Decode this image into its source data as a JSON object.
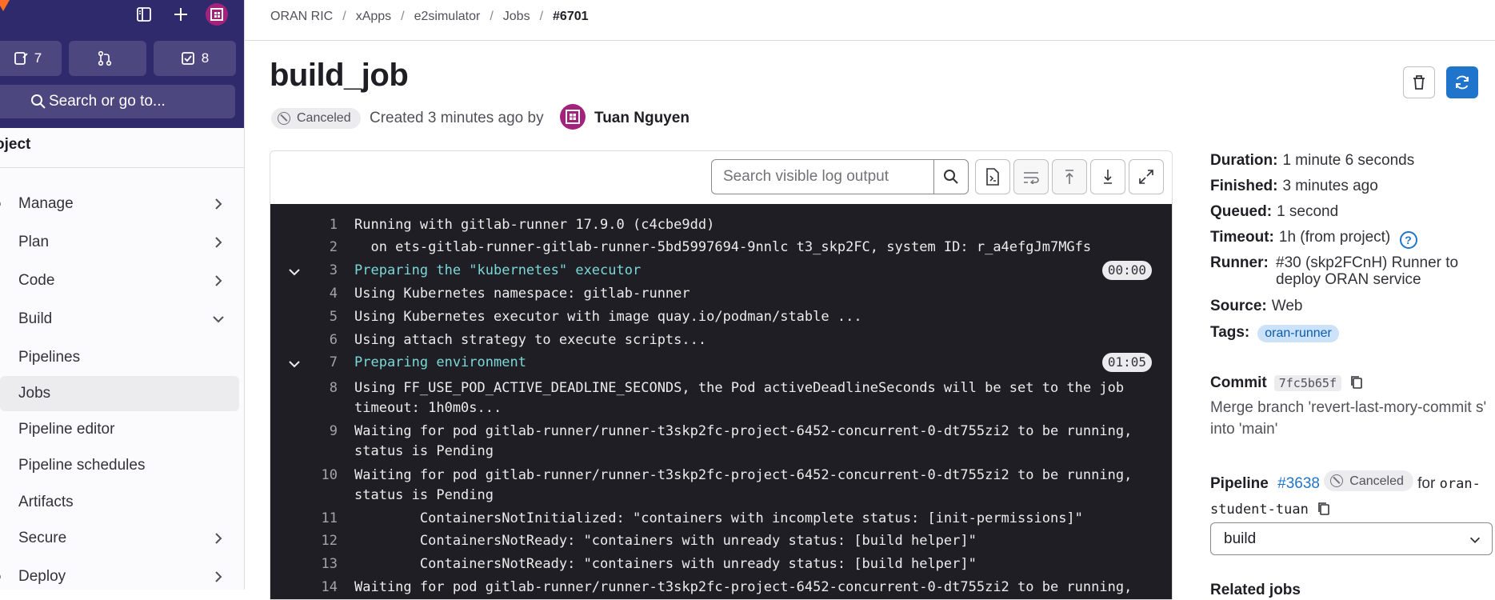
{
  "sidebar": {
    "counters": [
      {
        "icon": "issues-icon",
        "count": "7"
      },
      {
        "icon": "merge-request-icon",
        "count": ""
      },
      {
        "icon": "todo-icon",
        "count": "8"
      }
    ],
    "search_label": "Search or go to...",
    "project_heading": "oject",
    "nav": {
      "manage": "Manage",
      "plan": "Plan",
      "code": "Code",
      "build": "Build",
      "pipelines": "Pipelines",
      "jobs": "Jobs",
      "pipeline_editor": "Pipeline editor",
      "pipeline_schedules": "Pipeline schedules",
      "artifacts": "Artifacts",
      "secure": "Secure",
      "deploy": "Deploy"
    }
  },
  "breadcrumb": [
    "ORAN RIC",
    "xApps",
    "e2simulator",
    "Jobs",
    "#6701"
  ],
  "job": {
    "title": "build_job",
    "status": "Canceled",
    "created_text": "Created 3 minutes ago by",
    "user": "Tuan Nguyen"
  },
  "log": {
    "search_placeholder": "Search visible log output",
    "lines": [
      {
        "n": "1",
        "text": "Running with gitlab-runner 17.9.0 (c4cbe9dd)",
        "section": false
      },
      {
        "n": "2",
        "text": "  on ets-gitlab-runner-gitlab-runner-5bd5997694-9nnlc t3_skp2FC, system ID: r_a4efgJm7MGfs",
        "section": false
      },
      {
        "n": "3",
        "text": "Preparing the \"kubernetes\" executor",
        "section": true,
        "duration": "00:00"
      },
      {
        "n": "4",
        "text": "Using Kubernetes namespace: gitlab-runner",
        "section": false
      },
      {
        "n": "5",
        "text": "Using Kubernetes executor with image quay.io/podman/stable ...",
        "section": false
      },
      {
        "n": "6",
        "text": "Using attach strategy to execute scripts...",
        "section": false
      },
      {
        "n": "7",
        "text": "Preparing environment",
        "section": true,
        "duration": "01:05"
      },
      {
        "n": "8",
        "text": "Using FF_USE_POD_ACTIVE_DEADLINE_SECONDS, the Pod activeDeadlineSeconds will be set to the job\ntimeout: 1h0m0s...",
        "section": false
      },
      {
        "n": "9",
        "text": "Waiting for pod gitlab-runner/runner-t3skp2fc-project-6452-concurrent-0-dt755zi2 to be running,\nstatus is Pending",
        "section": false
      },
      {
        "n": "10",
        "text": "Waiting for pod gitlab-runner/runner-t3skp2fc-project-6452-concurrent-0-dt755zi2 to be running,\nstatus is Pending",
        "section": false
      },
      {
        "n": "11",
        "text": "        ContainersNotInitialized: \"containers with incomplete status: [init-permissions]\"",
        "section": false
      },
      {
        "n": "12",
        "text": "        ContainersNotReady: \"containers with unready status: [build helper]\"",
        "section": false
      },
      {
        "n": "13",
        "text": "        ContainersNotReady: \"containers with unready status: [build helper]\"",
        "section": false
      },
      {
        "n": "14",
        "text": "Waiting for pod gitlab-runner/runner-t3skp2fc-project-6452-concurrent-0-dt755zi2 to be running,",
        "section": false
      }
    ]
  },
  "details": {
    "duration_label": "Duration:",
    "duration": "1 minute 6 seconds",
    "finished_label": "Finished:",
    "finished": "3 minutes ago",
    "queued_label": "Queued:",
    "queued": "1 second",
    "timeout_label": "Timeout:",
    "timeout": "1h (from project)",
    "runner_label": "Runner:",
    "runner": "#30 (skp2FCnH) Runner to deploy ORAN service",
    "source_label": "Source:",
    "source": "Web",
    "tags_label": "Tags:",
    "tag": "oran-runner",
    "commit_label": "Commit",
    "commit_sha": "7fc5b65f",
    "commit_message": "Merge branch 'revert-last-mory-commit s' into 'main'",
    "pipeline_label": "Pipeline",
    "pipeline_id": "#3638",
    "pipeline_status": "Canceled",
    "for_text": "for",
    "branch": "oran-student-tuan",
    "stage": "build",
    "related_label": "Related jobs"
  },
  "colors": {
    "sidebar_top": "#2f2a6b",
    "accent": "#1f75cb",
    "log_bg": "#1f1e24",
    "section": "#7bd8d8"
  }
}
